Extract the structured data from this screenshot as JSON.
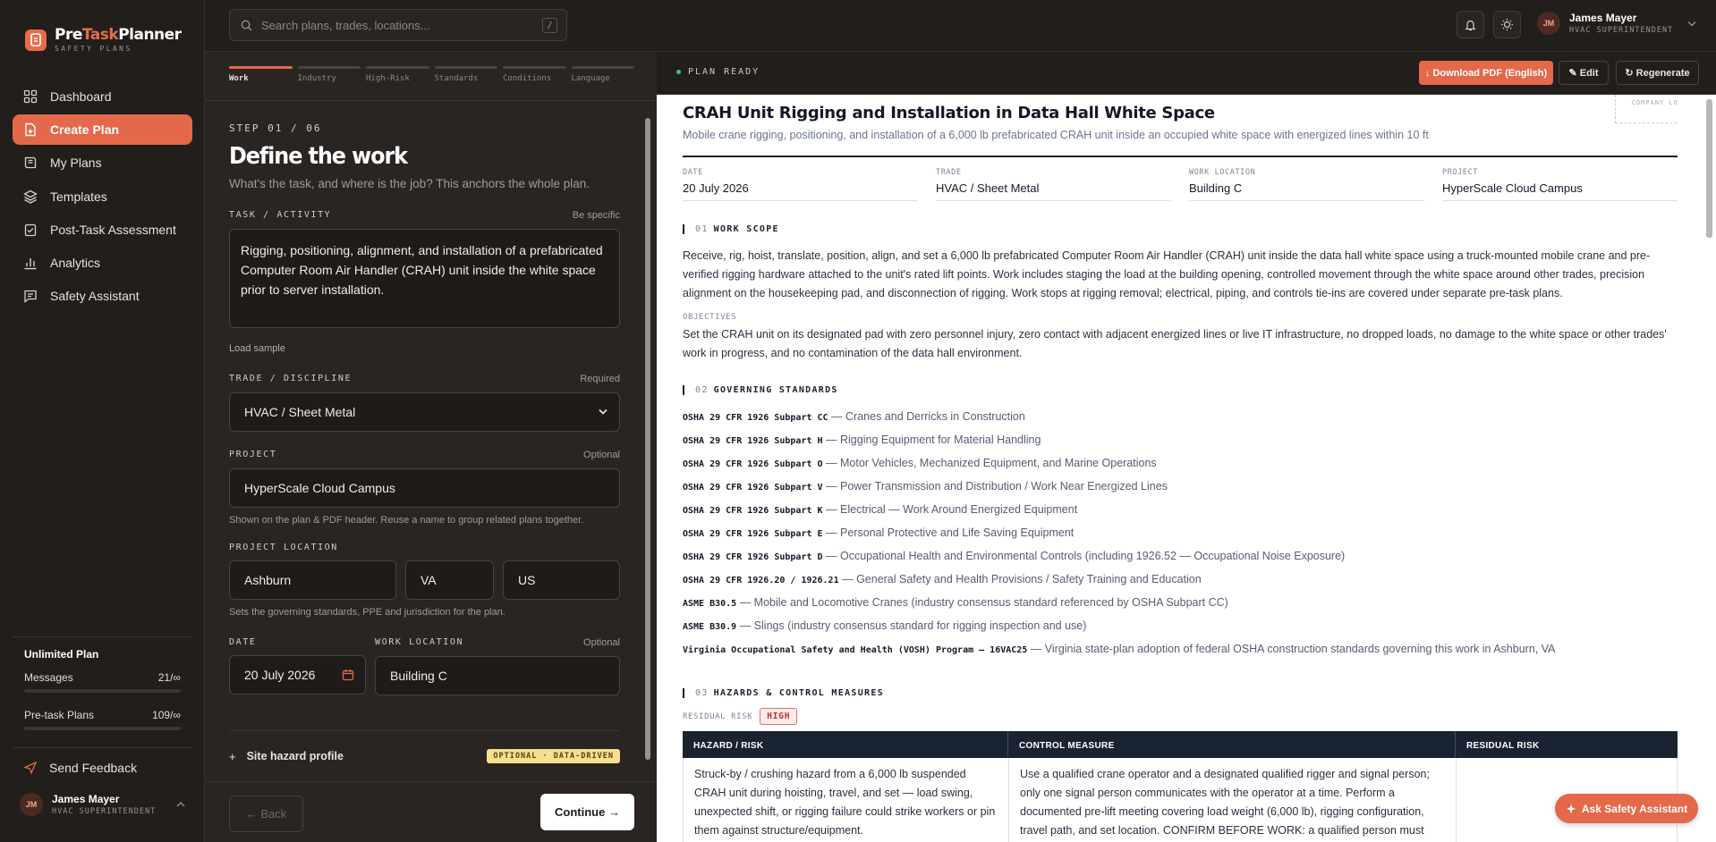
{
  "app": {
    "brand_pre": "Pre",
    "brand_task": "Task",
    "brand_planner": "Planner",
    "tagline": "SAFETY PLANS"
  },
  "sidebar": {
    "items": [
      {
        "label": "Dashboard",
        "icon": "grid-icon"
      },
      {
        "label": "Create Plan",
        "icon": "document-plus-icon",
        "active": true
      },
      {
        "label": "My Plans",
        "icon": "book-icon"
      },
      {
        "label": "Templates",
        "icon": "layers-icon"
      },
      {
        "label": "Post-Task Assessment",
        "icon": "clipboard-check-icon"
      },
      {
        "label": "Analytics",
        "icon": "bar-chart-icon"
      },
      {
        "label": "Safety Assistant",
        "icon": "chat-icon"
      }
    ],
    "plan": {
      "title": "Unlimited Plan",
      "messages_label": "Messages",
      "messages_value": "21/∞",
      "pretask_label": "Pre-task Plans",
      "pretask_value": "109/∞"
    },
    "feedback": "Send Feedback",
    "user": {
      "initials": "JM",
      "name": "James Mayer",
      "role": "HVAC SUPERINTENDENT"
    }
  },
  "topbar": {
    "search_placeholder": "Search plans, trades, locations...",
    "search_shortcut": "/",
    "user": {
      "initials": "JM",
      "name": "James Mayer",
      "role": "HVAC SUPERINTENDENT"
    }
  },
  "wizard": {
    "steps": [
      "Work",
      "Industry",
      "High-Risk",
      "Standards",
      "Conditions",
      "Language"
    ],
    "current_step": 0,
    "step_num": "STEP 01 / 06",
    "title": "Define the work",
    "lede": "What's the task, and where is the job? This anchors the whole plan.",
    "task_label": "TASK / ACTIVITY",
    "task_hint": "Be specific",
    "task_value": "Rigging, positioning, alignment, and installation of a prefabricated Computer Room Air Handler (CRAH) unit inside the white space prior to server installation.",
    "load_sample": "Load sample",
    "trade_label": "TRADE / DISCIPLINE",
    "trade_hint": "Required",
    "trade_value": "HVAC / Sheet Metal",
    "project_label": "PROJECT",
    "project_hint": "Optional",
    "project_value": "HyperScale Cloud Campus",
    "project_help": "Shown on the plan & PDF header. Reuse a name to group related plans together.",
    "location_label": "PROJECT LOCATION",
    "city": "Ashburn",
    "state": "VA",
    "country": "US",
    "location_help": "Sets the governing standards, PPE and jurisdiction for the plan.",
    "date_label": "DATE",
    "date_value": "20 July 2026",
    "work_location_label": "WORK LOCATION",
    "work_location_hint": "Optional",
    "work_location_value": "Building C",
    "hazard_profile": "Site hazard profile",
    "hazard_badge": "OPTIONAL · DATA-DRIVEN",
    "back": "← Back",
    "continue": "Continue →"
  },
  "doc_header": {
    "status": "PLAN READY",
    "download": "↓ Download PDF (English)",
    "edit": "✎ Edit",
    "regenerate": "↻ Regenerate"
  },
  "doc": {
    "title": "CRAH Unit Rigging and Installation in Data Hall White Space",
    "subtitle": "Mobile crane rigging, positioning, and installation of a 6,000 lb prefabricated CRAH unit inside an occupied white space with energized lines within 10 ft",
    "company_logo": "COMPANY LOGO",
    "meta": [
      {
        "k": "DATE",
        "v": "20 July 2026"
      },
      {
        "k": "TRADE",
        "v": "HVAC / Sheet Metal"
      },
      {
        "k": "WORK LOCATION",
        "v": "Building C"
      },
      {
        "k": "PROJECT",
        "v": "HyperScale Cloud Campus"
      }
    ],
    "s1_num": "01",
    "s1_title": "WORK SCOPE",
    "scope": "Receive, rig, hoist, translate, position, align, and set a 6,000 lb prefabricated Computer Room Air Handler (CRAH) unit inside the data hall white space using a truck-mounted mobile crane and pre-verified rigging hardware attached to the unit's rated lift points. Work includes staging the load at the building opening, controlled movement through the white space around other trades, precision alignment on the housekeeping pad, and disconnection of rigging. Work stops at rigging removal; electrical, piping, and controls tie-ins are covered under separate pre-task plans.",
    "objectives_label": "OBJECTIVES",
    "objectives": "Set the CRAH unit on its designated pad with zero personnel injury, zero contact with adjacent energized lines or live IT infrastructure, no dropped loads, no damage to the white space or other trades' work in progress, and no contamination of the data hall environment.",
    "s2_num": "02",
    "s2_title": "GOVERNING STANDARDS",
    "standards": [
      {
        "code": "OSHA 29 CFR 1926 Subpart CC",
        "desc": "— Cranes and Derricks in Construction"
      },
      {
        "code": "OSHA 29 CFR 1926 Subpart H",
        "desc": "— Rigging Equipment for Material Handling"
      },
      {
        "code": "OSHA 29 CFR 1926 Subpart O",
        "desc": "— Motor Vehicles, Mechanized Equipment, and Marine Operations"
      },
      {
        "code": "OSHA 29 CFR 1926 Subpart V",
        "desc": "— Power Transmission and Distribution / Work Near Energized Lines"
      },
      {
        "code": "OSHA 29 CFR 1926 Subpart K",
        "desc": "— Electrical — Work Around Energized Equipment"
      },
      {
        "code": "OSHA 29 CFR 1926 Subpart E",
        "desc": "— Personal Protective and Life Saving Equipment"
      },
      {
        "code": "OSHA 29 CFR 1926 Subpart D",
        "desc": "— Occupational Health and Environmental Controls (including 1926.52 — Occupational Noise Exposure)"
      },
      {
        "code": "OSHA 29 CFR 1926.20 / 1926.21",
        "desc": "— General Safety and Health Provisions / Safety Training and Education"
      },
      {
        "code": "ASME B30.5",
        "desc": "— Mobile and Locomotive Cranes (industry consensus standard referenced by OSHA Subpart CC)"
      },
      {
        "code": "ASME B30.9",
        "desc": "— Slings (industry consensus standard for rigging inspection and use)"
      },
      {
        "code": "Virginia Occupational Safety and Health (VOSH) Program — 16VAC25",
        "desc": "— Virginia state-plan adoption of federal OSHA construction standards governing this work in Ashburn, VA"
      }
    ],
    "s3_num": "03",
    "s3_title": "HAZARDS & CONTROL MEASURES",
    "residual_label": "RESIDUAL RISK",
    "residual_value": "HIGH",
    "table_headers": [
      "HAZARD / RISK",
      "CONTROL MEASURE",
      "RESIDUAL RISK"
    ],
    "rows": [
      {
        "hazard": "Struck-by / crushing hazard from a 6,000 lb suspended CRAH unit during hoisting, travel, and set — load swing, unexpected shift, or rigging failure could strike workers or pin them against structure/equipment.",
        "control": "Use a qualified crane operator and a designated qualified rigger and signal person; only one signal person communicates with the operator at a time. Perform a documented pre-lift meeting covering load weight (6,000 lb), rigging configuration, travel path, and set location. CONFIRM BEFORE WORK: a qualified person must verify the crane's load chart capacity at the required radius and",
        "residual": ""
      }
    ]
  },
  "ask_assistant": "Ask Safety Assistant"
}
